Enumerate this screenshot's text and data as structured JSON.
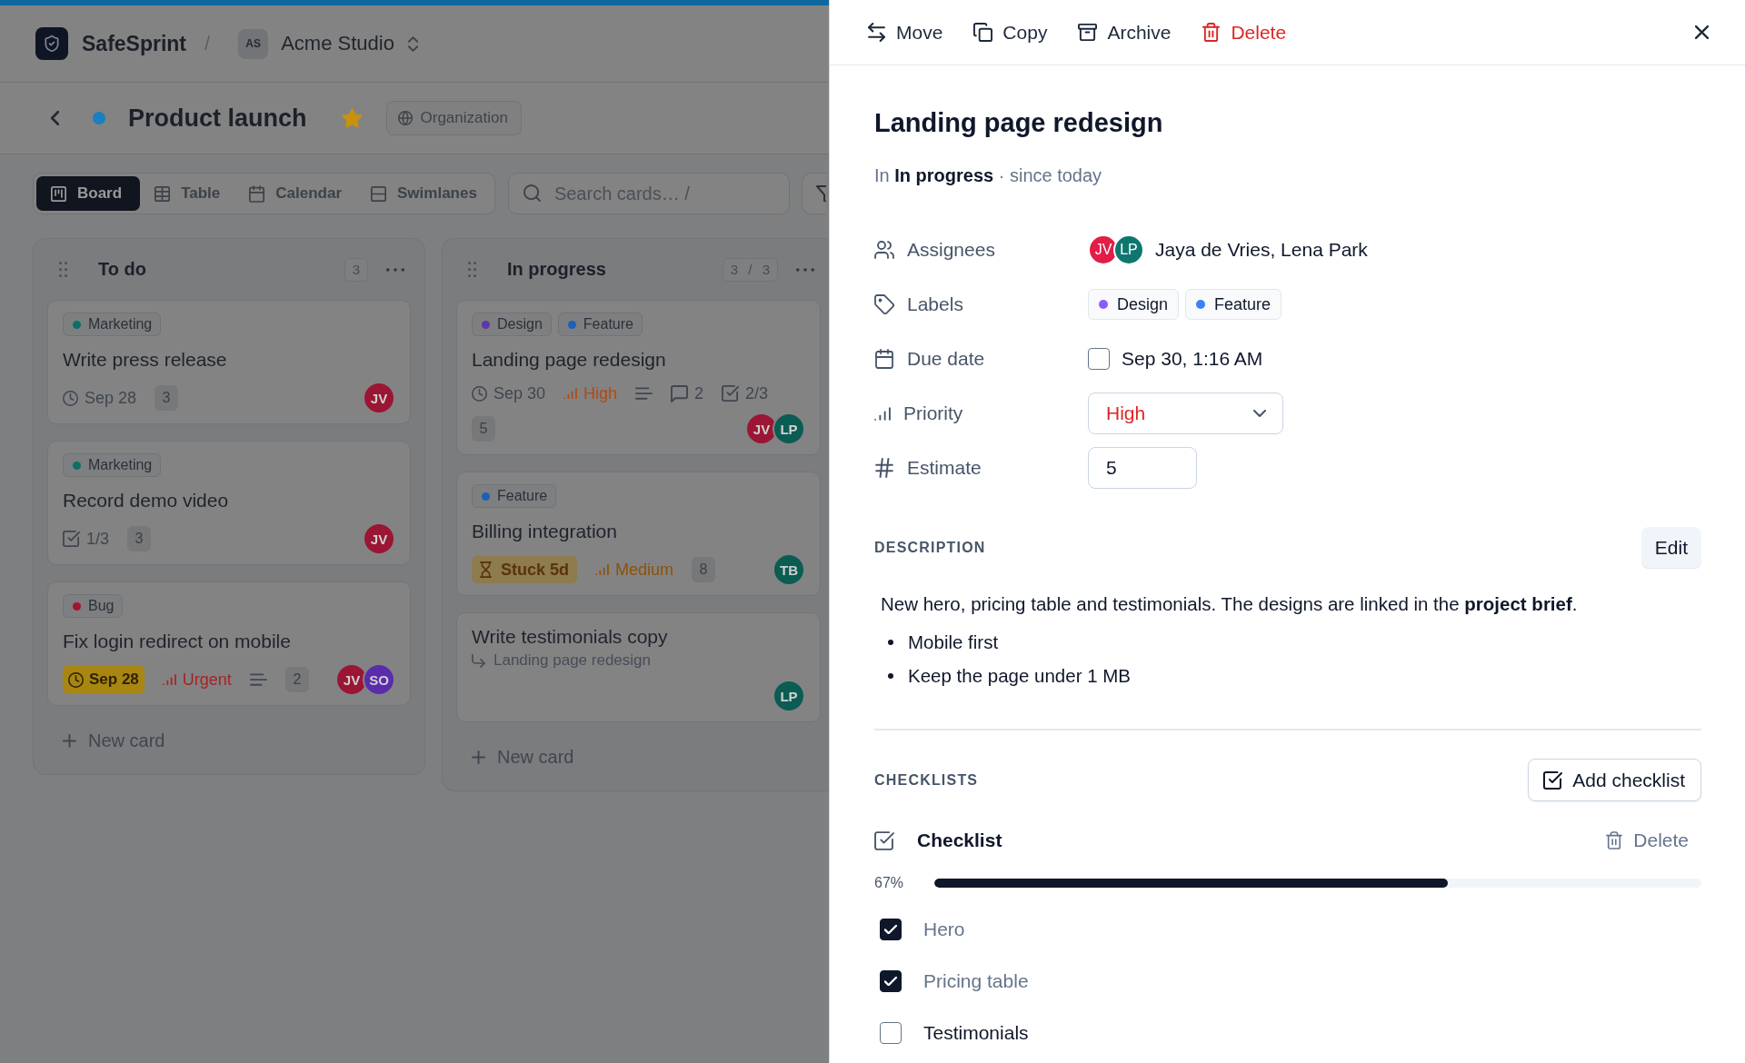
{
  "top_bar": {
    "app_name": "SafeSprint",
    "separator": "/",
    "workspace_initials": "AS",
    "workspace_name": "Acme Studio"
  },
  "project": {
    "name": "Product launch",
    "starred": true,
    "visibility": "Organization"
  },
  "views": [
    {
      "kind": "board",
      "label": "Board",
      "selected": true
    },
    {
      "kind": "table",
      "label": "Table",
      "selected": false
    },
    {
      "kind": "calendar",
      "label": "Calendar",
      "selected": false
    },
    {
      "kind": "swimlanes",
      "label": "Swimlanes",
      "selected": false
    }
  ],
  "search": {
    "placeholder": "Search cards… /"
  },
  "columns": [
    {
      "title": "To do",
      "count": "3",
      "new_card": "New card",
      "cards": [
        {
          "labels": [
            {
              "name": "Marketing",
              "color": "#0c6e66"
            }
          ],
          "title": "Write press release",
          "meta": [
            {
              "kind": "due",
              "text": "Sep 28",
              "overdue": false
            },
            {
              "kind": "estimate",
              "text": "3"
            }
          ],
          "assignees": [
            {
              "initials": "JV",
              "color": "#9b1634"
            }
          ]
        },
        {
          "labels": [
            {
              "name": "Marketing",
              "color": "#0c6e66"
            }
          ],
          "title": "Record demo video",
          "meta": [
            {
              "kind": "checklist",
              "text": "1/3"
            },
            {
              "kind": "estimate",
              "text": "3"
            }
          ],
          "assignees": [
            {
              "initials": "JV",
              "color": "#9b1634"
            }
          ]
        },
        {
          "labels": [
            {
              "name": "Bug",
              "color": "#a3142f"
            }
          ],
          "title": "Fix login redirect on mobile",
          "meta": [
            {
              "kind": "due",
              "text": "Sep 28",
              "overdue": true
            },
            {
              "kind": "priority",
              "text": "Urgent",
              "color": "#a52424"
            },
            {
              "kind": "description"
            },
            {
              "kind": "estimate",
              "text": "2"
            }
          ],
          "assignees": [
            {
              "initials": "JV",
              "color": "#9b1634"
            },
            {
              "initials": "SO",
              "color": "#5a2cab"
            }
          ]
        }
      ]
    },
    {
      "title": "In progress",
      "count": "3 / 3",
      "new_card": "New card",
      "cards": [
        {
          "labels": [
            {
              "name": "Design",
              "color": "#5a3aa8"
            },
            {
              "name": "Feature",
              "color": "#1f5fb8"
            }
          ],
          "title": "Landing page redesign",
          "meta": [
            {
              "kind": "due",
              "text": "Sep 30",
              "overdue": false
            },
            {
              "kind": "priority",
              "text": "High",
              "color": "#b24a12"
            },
            {
              "kind": "description"
            },
            {
              "kind": "comments",
              "text": "2"
            },
            {
              "kind": "checklist",
              "text": "2/3"
            },
            {
              "kind": "estimate",
              "text": "5"
            }
          ],
          "assignees": [
            {
              "initials": "JV",
              "color": "#9b1634"
            },
            {
              "initials": "LP",
              "color": "#0b5c53"
            }
          ]
        },
        {
          "labels": [
            {
              "name": "Feature",
              "color": "#1f5fb8"
            }
          ],
          "title": "Billing integration",
          "meta": [
            {
              "kind": "stuck",
              "text": "Stuck 5d"
            },
            {
              "kind": "priority",
              "text": "Medium",
              "color": "#8c5206"
            },
            {
              "kind": "estimate",
              "text": "8"
            }
          ],
          "assignees": [
            {
              "initials": "TB",
              "color": "#0b5c53"
            }
          ]
        },
        {
          "title": "Write testimonials copy",
          "parent": "Landing page redesign",
          "assignees": [
            {
              "initials": "LP",
              "color": "#0b5c53"
            }
          ]
        }
      ]
    }
  ],
  "panel": {
    "actions": [
      {
        "kind": "move",
        "label": "Move"
      },
      {
        "kind": "copy",
        "label": "Copy"
      },
      {
        "kind": "archive",
        "label": "Archive"
      },
      {
        "kind": "delete",
        "label": "Delete"
      }
    ],
    "title": "Landing page redesign",
    "status_line": "In **In progress** · since today",
    "properties": [
      {
        "kind": "assignees",
        "label": "Assignees",
        "avatars": [
          {
            "initials": "JV",
            "color": "#e11d48"
          },
          {
            "initials": "LP",
            "color": "#0f766e"
          }
        ],
        "value": "Jaya de Vries, Lena Park"
      },
      {
        "kind": "labels",
        "label": "Labels",
        "labels": [
          {
            "name": "Design",
            "color": "#8b5cf6"
          },
          {
            "name": "Feature",
            "color": "#3b82f6"
          }
        ]
      },
      {
        "kind": "date",
        "label": "Due date",
        "checked": false,
        "value": "Sep 30, 1:16 AM"
      },
      {
        "kind": "select",
        "label": "Priority",
        "value": "High"
      },
      {
        "kind": "number",
        "label": "Estimate",
        "value": "5"
      }
    ],
    "description": {
      "heading": "DESCRIPTION",
      "edit_button": "Edit",
      "text": "New hero, pricing table and testimonials. The designs are linked in the **project brief**.",
      "bullets": [
        "Mobile first",
        "Keep the page under 1 MB"
      ]
    },
    "checklists": {
      "heading": "CHECKLISTS",
      "add_button": "Add checklist",
      "lists": [
        {
          "title": "Checklist",
          "delete_button": "Delete",
          "percent": "67%",
          "level": 0.67,
          "items": [
            {
              "text": "Hero",
              "checked": true
            },
            {
              "text": "Pricing table",
              "checked": true
            },
            {
              "text": "Testimonials",
              "checked": false
            }
          ]
        }
      ]
    }
  }
}
